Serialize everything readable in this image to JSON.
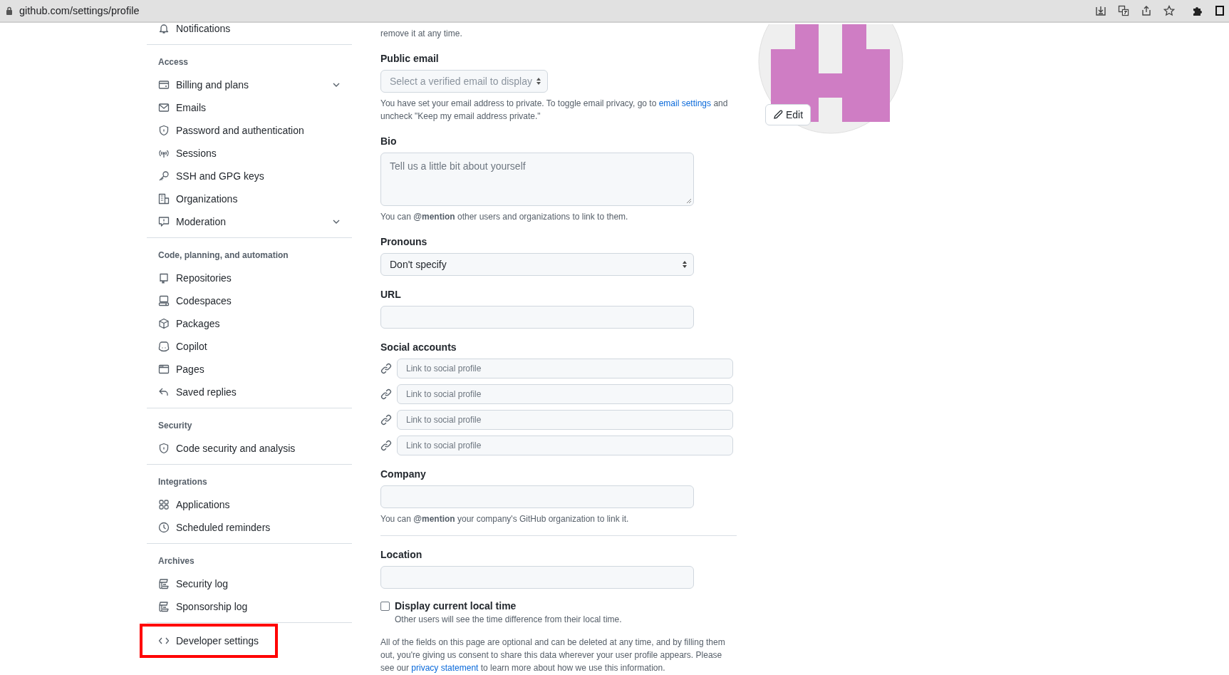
{
  "browser": {
    "url": "github.com/settings/profile"
  },
  "sidebar": {
    "sections": [
      {
        "items": [
          {
            "label": "Notifications",
            "kind": "link",
            "highlighted": false
          }
        ]
      },
      {
        "heading": "Access",
        "items": [
          {
            "label": "Billing and plans",
            "kind": "group",
            "expanded": false,
            "highlighted": false
          },
          {
            "label": "Emails",
            "kind": "link",
            "highlighted": false
          },
          {
            "label": "Password and authentication",
            "kind": "link",
            "highlighted": false
          },
          {
            "label": "Sessions",
            "kind": "link",
            "highlighted": false
          },
          {
            "label": "SSH and GPG keys",
            "kind": "link",
            "highlighted": false
          },
          {
            "label": "Organizations",
            "kind": "link",
            "highlighted": false
          },
          {
            "label": "Moderation",
            "kind": "group",
            "expanded": false,
            "highlighted": false
          }
        ]
      },
      {
        "heading": "Code, planning, and automation",
        "items": [
          {
            "label": "Repositories",
            "kind": "link",
            "highlighted": false
          },
          {
            "label": "Codespaces",
            "kind": "link",
            "highlighted": false
          },
          {
            "label": "Packages",
            "kind": "link",
            "highlighted": false
          },
          {
            "label": "Copilot",
            "kind": "link",
            "highlighted": false
          },
          {
            "label": "Pages",
            "kind": "link",
            "highlighted": false
          },
          {
            "label": "Saved replies",
            "kind": "link",
            "highlighted": false
          }
        ]
      },
      {
        "heading": "Security",
        "items": [
          {
            "label": "Code security and analysis",
            "kind": "link",
            "highlighted": false
          }
        ]
      },
      {
        "heading": "Integrations",
        "items": [
          {
            "label": "Applications",
            "kind": "link",
            "highlighted": false
          },
          {
            "label": "Scheduled reminders",
            "kind": "link",
            "highlighted": false
          }
        ]
      },
      {
        "heading": "Archives",
        "items": [
          {
            "label": "Security log",
            "kind": "link",
            "highlighted": false
          },
          {
            "label": "Sponsorship log",
            "kind": "link",
            "highlighted": false
          }
        ]
      },
      {
        "items": [
          {
            "label": "Developer settings",
            "kind": "link",
            "highlighted": true
          }
        ]
      }
    ]
  },
  "form": {
    "name_note": "remove it at any time.",
    "public_email": {
      "label": "Public email",
      "value": "Select a verified email to display",
      "note_before": "You have set your email address to private. To toggle email privacy, go to ",
      "note_link": "email settings",
      "note_after": " and uncheck \"Keep my email address private.\""
    },
    "bio": {
      "label": "Bio",
      "placeholder": "Tell us a little bit about yourself",
      "note": "You can **@mention** other users and organizations to link to them."
    },
    "pronouns": {
      "label": "Pronouns",
      "value": "Don't specify"
    },
    "url": {
      "label": "URL"
    },
    "social_accounts": {
      "label": "Social accounts",
      "fields": [
        {
          "placeholder": "Link to social profile"
        },
        {
          "placeholder": "Link to social profile"
        },
        {
          "placeholder": "Link to social profile"
        },
        {
          "placeholder": "Link to social profile"
        }
      ]
    },
    "company": {
      "label": "Company",
      "note": "You can **@mention** your company's GitHub organization to link it."
    },
    "location": {
      "label": "Location"
    },
    "local_time": {
      "label": "Display current local time",
      "checked": false,
      "note": "Other users will see the time difference from their local time."
    },
    "footer_before": "All of the fields on this page are optional and can be deleted at any time, and by filling them out, you're giving us consent to share this data wherever your user profile appears. Please see our ",
    "footer_link": "privacy statement",
    "footer_after": " to learn more about how we use this information."
  },
  "avatar": {
    "edit_button": "Edit"
  }
}
